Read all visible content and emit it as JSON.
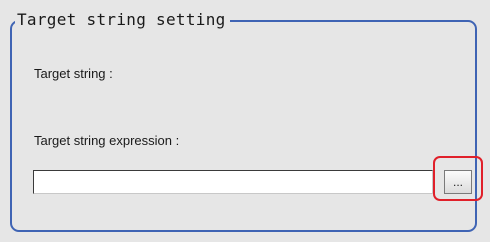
{
  "group": {
    "title": "Target string setting"
  },
  "fields": {
    "target_string_label": "Target string :",
    "target_string_value": "",
    "expression_label": "Target string expression :",
    "expression_value": "",
    "browse_button_label": "..."
  },
  "colors": {
    "panel_background": "#e6e6e6",
    "group_border": "#3f64b4",
    "highlight_border": "#e0202a"
  },
  "icons": {
    "browse": "ellipsis-icon"
  }
}
